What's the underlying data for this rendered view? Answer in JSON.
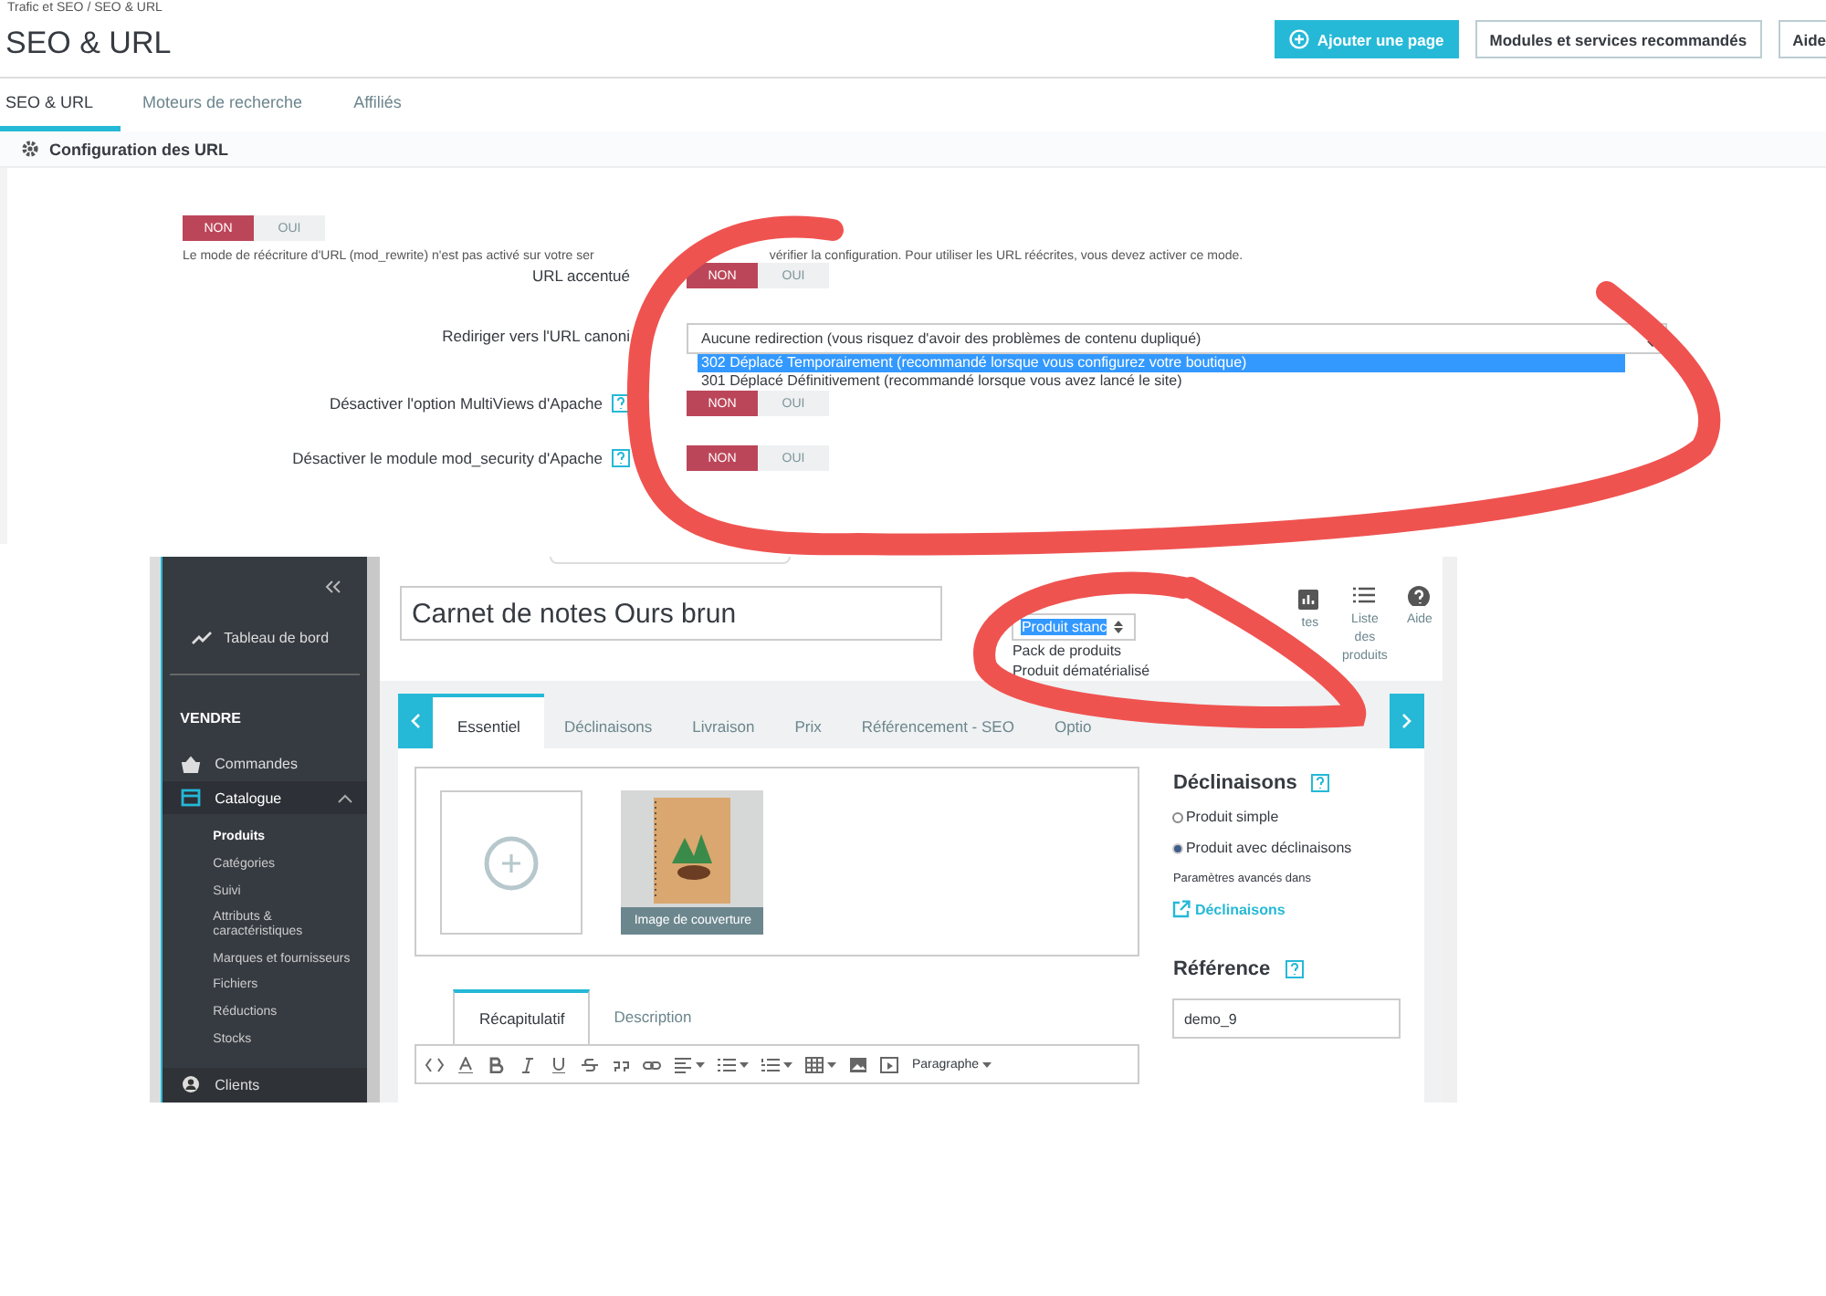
{
  "seo_screen": {
    "breadcrumb": "Trafic et SEO / SEO & URL",
    "title": "SEO & URL",
    "header_buttons": [
      {
        "label": "Ajouter une page",
        "kind": "primary"
      },
      {
        "label": "Modules et services recommandés",
        "kind": "default"
      },
      {
        "label": "Aide",
        "kind": "default"
      }
    ],
    "tabs": [
      {
        "label": "SEO & URL",
        "selected": true
      },
      {
        "label": "Moteurs de recherche",
        "selected": false
      },
      {
        "label": "Affiliés",
        "selected": false
      }
    ],
    "panel_title": "Configuration des URL",
    "rewrite_toggle": [
      {
        "label": "NON",
        "selected": true
      },
      {
        "label": "OUI",
        "selected": false
      }
    ],
    "rewrite_help": [
      "Le mode de réécriture d'URL (mod_rewrite) n'est pas activé sur votre ser",
      "vérifier la configuration. Pour utiliser les URL réécrites, vous devez activer ce mode."
    ],
    "settings": [
      {
        "kind": "toggle",
        "label": "URL accentué",
        "help": false,
        "options": [
          {
            "label": "NON",
            "selected": true
          },
          {
            "label": "OUI",
            "selected": false
          }
        ]
      },
      {
        "kind": "select",
        "label": "Rediriger vers l'URL canoni",
        "help": false,
        "value": "Aucune redirection (vous risquez d'avoir des problèmes de contenu dupliqué)",
        "options": [
          {
            "label": "302 Déplacé Temporairement (recommandé lorsque vous configurez votre boutique)",
            "selected": true
          },
          {
            "label": "301 Déplacé Définitivement (recommandé lorsque vous avez lancé le site)",
            "selected": false
          }
        ]
      },
      {
        "kind": "toggle",
        "label": "Désactiver l'option MultiViews d'Apache",
        "help": true,
        "options": [
          {
            "label": "NON",
            "selected": true
          },
          {
            "label": "OUI",
            "selected": false
          }
        ]
      },
      {
        "kind": "toggle",
        "label": "Désactiver le module mod_security d'Apache",
        "help": true,
        "options": [
          {
            "label": "NON",
            "selected": true
          },
          {
            "label": "OUI",
            "selected": false
          }
        ]
      }
    ]
  },
  "product_screen": {
    "sidebar": {
      "dashboard": "Tableau de bord",
      "section": "VENDRE",
      "items": [
        {
          "label": "Commandes",
          "selected": false
        },
        {
          "label": "Catalogue",
          "selected": true,
          "children": [
            {
              "label": "Produits",
              "selected": true
            },
            {
              "label": "Catégories",
              "selected": false
            },
            {
              "label": "Suivi",
              "selected": false
            },
            {
              "label": "Attributs & caractéristiques",
              "selected": false
            },
            {
              "label": "Marques et fournisseurs",
              "selected": false
            },
            {
              "label": "Fichiers",
              "selected": false
            },
            {
              "label": "Réductions",
              "selected": false
            },
            {
              "label": "Stocks",
              "selected": false
            }
          ]
        },
        {
          "label": "Clients",
          "selected": false
        }
      ]
    },
    "product_name": "Carnet de notes Ours brun",
    "product_type_options": [
      {
        "label": "Produit stanc",
        "selected": true
      },
      {
        "label": "Pack de produits",
        "selected": false
      },
      {
        "label": "Produit dématérialisé",
        "selected": false
      }
    ],
    "toolbar": [
      {
        "kind": "stats",
        "label": "tes"
      },
      {
        "kind": "list",
        "label": "Liste des produits"
      },
      {
        "kind": "help",
        "label": "Aide"
      }
    ],
    "tabs": [
      {
        "label": "Essentiel",
        "selected": true
      },
      {
        "label": "Déclinaisons",
        "selected": false
      },
      {
        "label": "Livraison",
        "selected": false
      },
      {
        "label": "Prix",
        "selected": false
      },
      {
        "label": "Référencement - SEO",
        "selected": false
      },
      {
        "label": "Optio",
        "selected": false
      }
    ],
    "cover_caption": "Image de couverture",
    "combinations": {
      "title": "Déclinaisons",
      "options": [
        {
          "label": "Produit simple",
          "selected": false
        },
        {
          "label": "Produit avec déclinaisons",
          "selected": true
        }
      ],
      "note": "Paramètres avancés dans",
      "link": "Déclinaisons"
    },
    "reference": {
      "title": "Référence",
      "value": "demo_9"
    },
    "editor_tabs": [
      {
        "label": "Récapitulatif",
        "selected": true
      },
      {
        "label": "Description",
        "selected": false
      }
    ],
    "editor_format": "Paragraphe"
  }
}
